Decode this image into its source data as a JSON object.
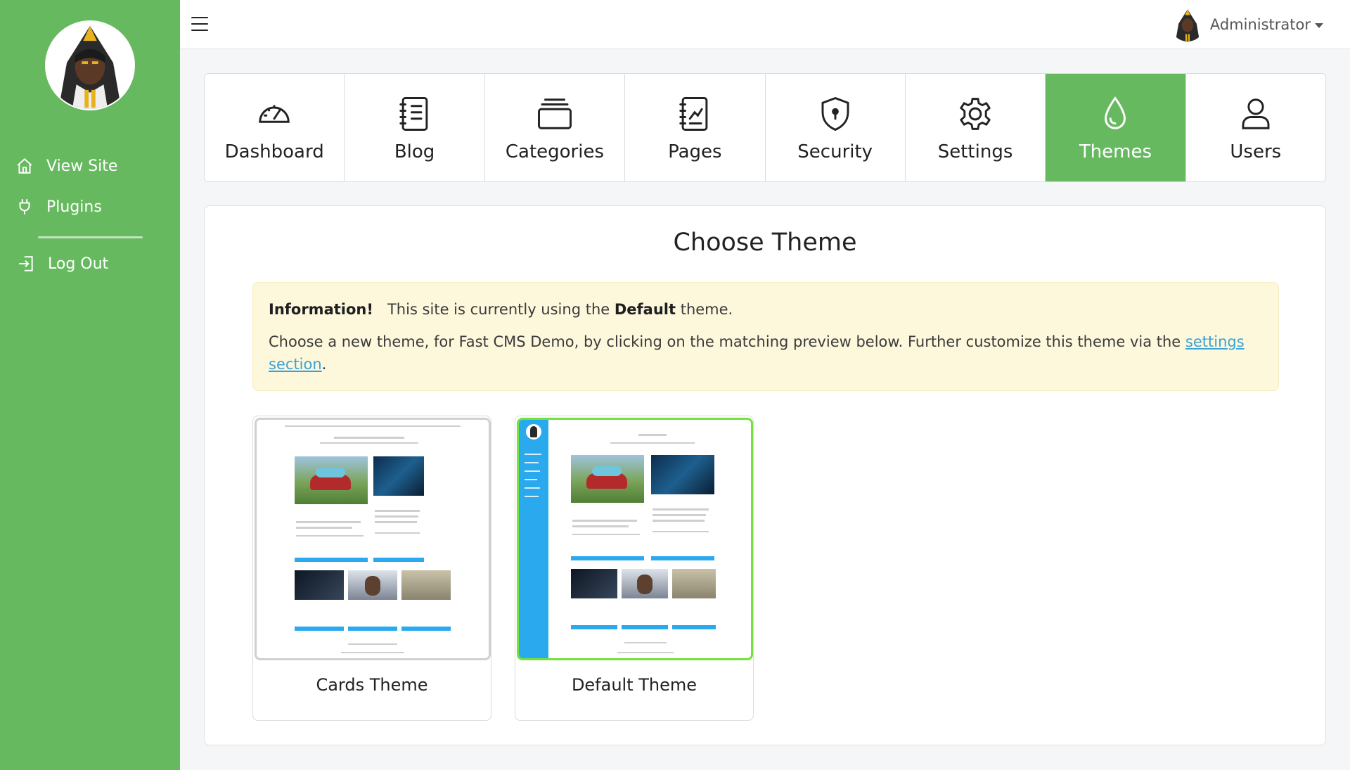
{
  "sidebar": {
    "items": [
      {
        "label": "View Site",
        "icon": "home-icon"
      },
      {
        "label": "Plugins",
        "icon": "plug-icon"
      },
      {
        "label": "Log Out",
        "icon": "logout-icon"
      }
    ]
  },
  "topbar": {
    "user": "Administrator"
  },
  "nav": {
    "tiles": [
      {
        "label": "Dashboard",
        "icon": "gauge-icon"
      },
      {
        "label": "Blog",
        "icon": "document-list-icon"
      },
      {
        "label": "Categories",
        "icon": "folders-icon"
      },
      {
        "label": "Pages",
        "icon": "pages-icon"
      },
      {
        "label": "Security",
        "icon": "shield-icon"
      },
      {
        "label": "Settings",
        "icon": "gear-icon"
      },
      {
        "label": "Themes",
        "icon": "droplet-icon",
        "active": true
      },
      {
        "label": "Users",
        "icon": "user-icon"
      }
    ]
  },
  "main": {
    "title": "Choose Theme",
    "alert": {
      "heading": "Information!",
      "line1_pre": "This site is currently using the",
      "line1_theme": "Default",
      "line1_post": "theme.",
      "line2_pre": "Choose a new theme, for Fast CMS Demo, by clicking on the matching preview below. Further customize this theme via the",
      "link_text": "settings section",
      "line2_post": "."
    },
    "themes": [
      {
        "label": "Cards Theme",
        "selected": false
      },
      {
        "label": "Default Theme",
        "selected": true
      }
    ]
  },
  "colors": {
    "brand_green": "#67b960",
    "selected_border": "#74e23c",
    "alert_bg": "#fdf7dc",
    "link": "#3aa3d6"
  }
}
